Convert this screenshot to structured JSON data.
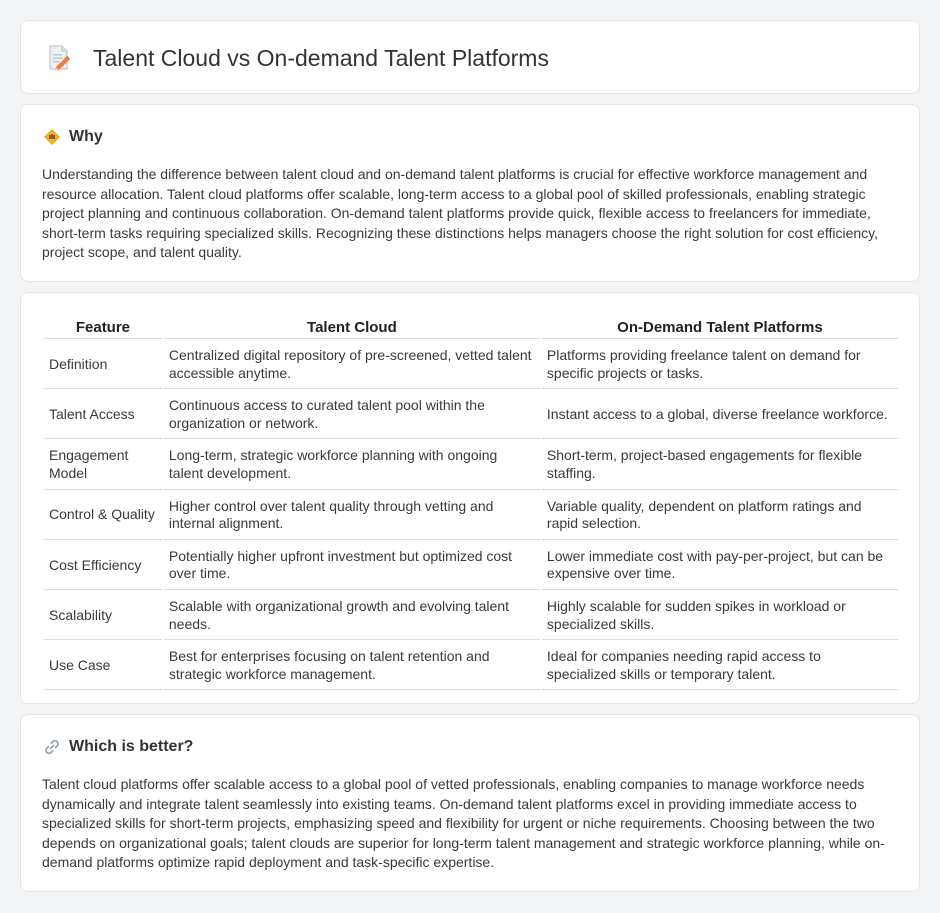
{
  "page": {
    "title": "Talent Cloud vs On-demand Talent Platforms",
    "title_icon": "document-pencil-icon"
  },
  "why": {
    "icon": "diamond-warning-icon",
    "heading": "Why",
    "text": "Understanding the difference between talent cloud and on-demand talent platforms is crucial for effective workforce management and resource allocation. Talent cloud platforms offer scalable, long-term access to a global pool of skilled professionals, enabling strategic project planning and continuous collaboration. On-demand talent platforms provide quick, flexible access to freelancers for immediate, short-term tasks requiring specialized skills. Recognizing these distinctions helps managers choose the right solution for cost efficiency, project scope, and talent quality."
  },
  "table": {
    "headers": [
      "Feature",
      "Talent Cloud",
      "On-Demand Talent Platforms"
    ],
    "rows": [
      [
        "Definition",
        "Centralized digital repository of pre-screened, vetted talent accessible anytime.",
        "Platforms providing freelance talent on demand for specific projects or tasks."
      ],
      [
        "Talent Access",
        "Continuous access to curated talent pool within the organization or network.",
        "Instant access to a global, diverse freelance workforce."
      ],
      [
        "Engagement Model",
        "Long-term, strategic workforce planning with ongoing talent development.",
        "Short-term, project-based engagements for flexible staffing."
      ],
      [
        "Control & Quality",
        "Higher control over talent quality through vetting and internal alignment.",
        "Variable quality, dependent on platform ratings and rapid selection."
      ],
      [
        "Cost Efficiency",
        "Potentially higher upfront investment but optimized cost over time.",
        "Lower immediate cost with pay-per-project, but can be expensive over time."
      ],
      [
        "Scalability",
        "Scalable with organizational growth and evolving talent needs.",
        "Highly scalable for sudden spikes in workload or specialized skills."
      ],
      [
        "Use Case",
        "Best for enterprises focusing on talent retention and strategic workforce management.",
        "Ideal for companies needing rapid access to specialized skills or temporary talent."
      ]
    ]
  },
  "better": {
    "icon": "link-icon",
    "heading": "Which is better?",
    "text": "Talent cloud platforms offer scalable access to a global pool of vetted professionals, enabling companies to manage workforce needs dynamically and integrate talent seamlessly into existing teams. On-demand talent platforms excel in providing immediate access to specialized skills for short-term projects, emphasizing speed and flexibility for urgent or niche requirements. Choosing between the two depends on organizational goals; talent clouds are superior for long-term talent management and strategic workforce planning, while on-demand platforms optimize rapid deployment and task-specific expertise."
  }
}
